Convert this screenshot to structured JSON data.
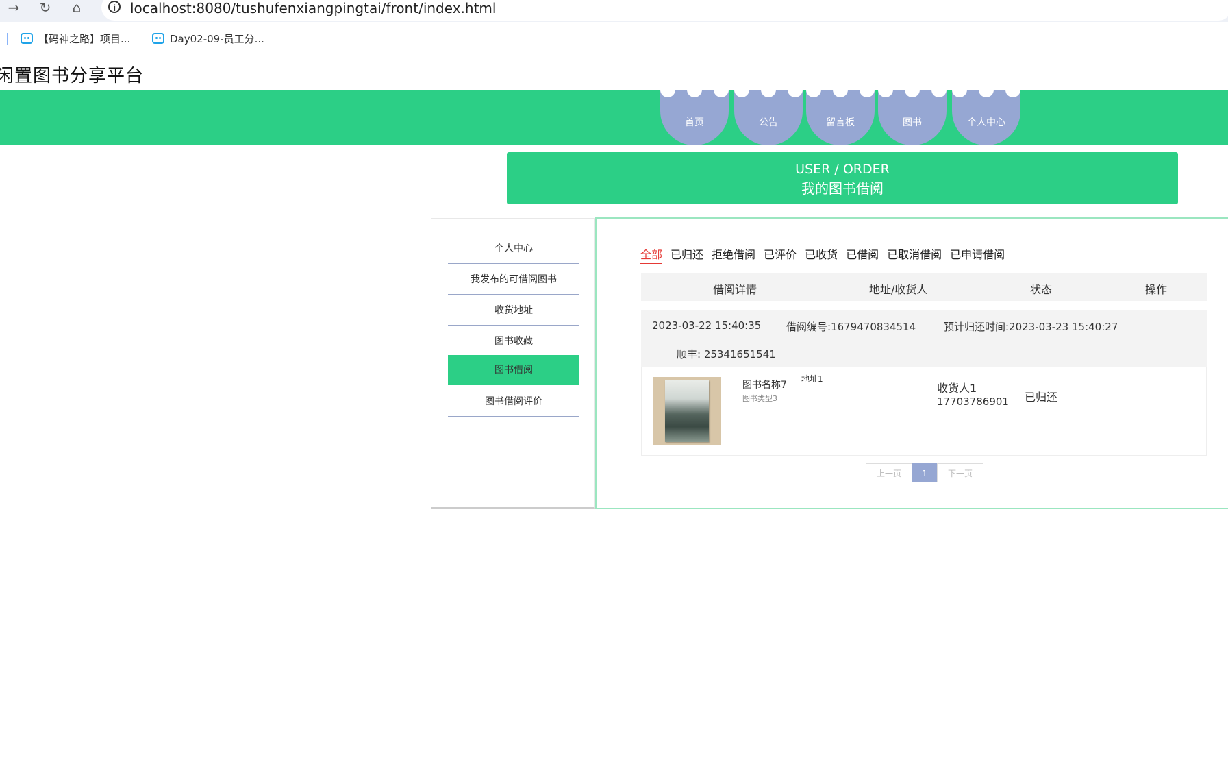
{
  "browser": {
    "url": "localhost:8080/tushufenxiangpingtai/front/index.html",
    "bookmarks": [
      "【码神之路】项目...",
      "Day02-09-员工分..."
    ]
  },
  "site": {
    "title": "闲置图书分享平台"
  },
  "nav": {
    "items": [
      "首页",
      "公告",
      "留言板",
      "图书",
      "个人中心"
    ]
  },
  "banner": {
    "en": "USER / ORDER",
    "cn": "我的图书借阅"
  },
  "sidebar": {
    "items": [
      "个人中心",
      "我发布的可借阅图书",
      "收货地址",
      "图书收藏",
      "图书借阅",
      "图书借阅评价"
    ],
    "active_index": 4
  },
  "tabs": {
    "items": [
      "全部",
      "已归还",
      "拒绝借阅",
      "已评价",
      "已收货",
      "已借阅",
      "已取消借阅",
      "已申请借阅"
    ],
    "active_index": 0
  },
  "table": {
    "headers": [
      "借阅详情",
      "地址/收货人",
      "状态",
      "操作"
    ]
  },
  "order": {
    "time": "2023-03-22 15:40:35",
    "number": "借阅编号:1679470834514",
    "due": "预计归还时间:2023-03-23 15:40:27",
    "courier": "顺丰:  25341651541",
    "book_name": "图书名称7",
    "book_type": "图书类型3",
    "address": "地址1",
    "receiver": "收货人1",
    "phone": "17703786901",
    "status": "已归还"
  },
  "pager": {
    "prev": "上一页",
    "current": "1",
    "next": "下一页"
  }
}
